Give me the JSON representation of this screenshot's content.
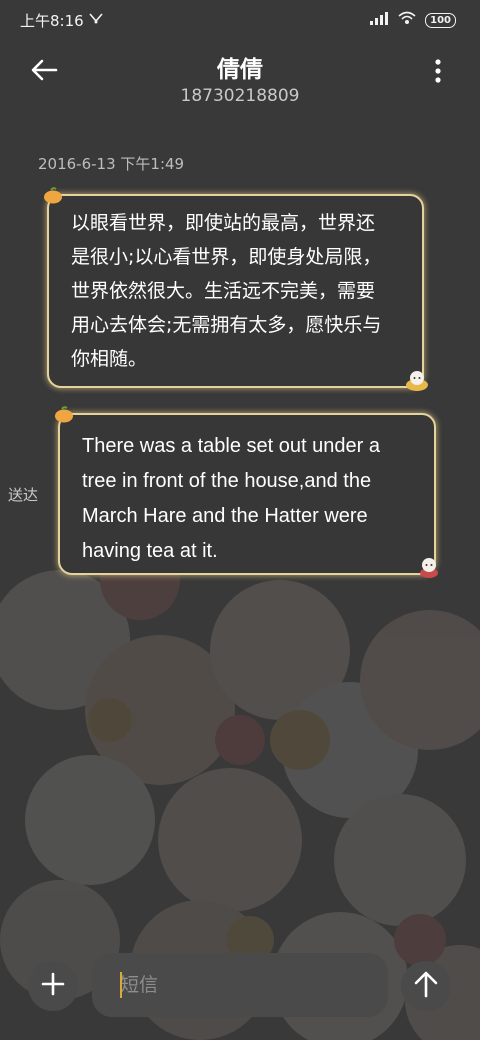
{
  "status_bar": {
    "time": "上午8:16",
    "battery": "100"
  },
  "header": {
    "contact_name": "倩倩",
    "contact_number": "18730218809"
  },
  "conversation": {
    "timestamp": "2016-6-13 下午1:49",
    "messages": [
      {
        "text_lines": [
          "以眼看世界，即使站的最高，世界还",
          "是很小;以心看世界，即使身处局限，",
          "世界依然很大。生活远不完美，需要",
          "用心去体会;无需拥有太多，愿快乐与",
          "你相随。"
        ]
      },
      {
        "text_lines": [
          "There was a table set out under a",
          "tree in front of the house,and the",
          "March Hare and the Hatter were",
          "having tea at it."
        ],
        "status": "送达"
      }
    ]
  },
  "composer": {
    "placeholder": "短信"
  },
  "icons": {
    "back": "back-arrow-icon",
    "menu": "more-vertical-icon",
    "add": "plus-icon",
    "send": "send-arrow-up-icon"
  },
  "colors": {
    "background": "#393939",
    "bubble_border": "#e6d39c",
    "cursor": "#d9a93b"
  }
}
